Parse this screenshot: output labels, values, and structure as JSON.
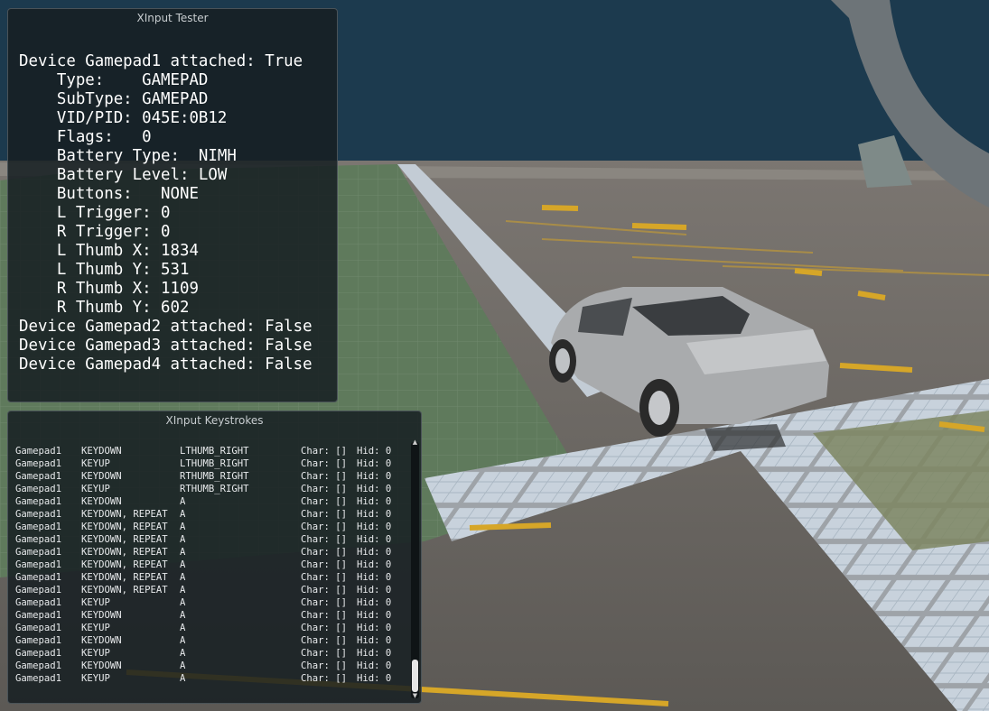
{
  "tester": {
    "title": "XInput Tester",
    "lines": [
      "Device Gamepad1 attached: True",
      "    Type:    GAMEPAD",
      "    SubType: GAMEPAD",
      "    VID/PID: 045E:0B12",
      "    Flags:   0",
      "    Battery Type:  NIMH",
      "    Battery Level: LOW",
      "    Buttons:   NONE",
      "    L Trigger: 0",
      "    R Trigger: 0",
      "    L Thumb X: 1834",
      "    L Thumb Y: 531",
      "    R Thumb X: 1109",
      "    R Thumb Y: 602",
      "Device Gamepad2 attached: False",
      "Device Gamepad3 attached: False",
      "Device Gamepad4 attached: False"
    ]
  },
  "keystrokes": {
    "title": "XInput Keystrokes",
    "rows": [
      {
        "device": "Gamepad1",
        "event": "KEYDOWN",
        "button": "LTHUMB_RIGHT",
        "char": "Char: []",
        "hid": "Hid: 0"
      },
      {
        "device": "Gamepad1",
        "event": "KEYUP",
        "button": "LTHUMB_RIGHT",
        "char": "Char: []",
        "hid": "Hid: 0"
      },
      {
        "device": "Gamepad1",
        "event": "KEYDOWN",
        "button": "RTHUMB_RIGHT",
        "char": "Char: []",
        "hid": "Hid: 0"
      },
      {
        "device": "Gamepad1",
        "event": "KEYUP",
        "button": "RTHUMB_RIGHT",
        "char": "Char: []",
        "hid": "Hid: 0"
      },
      {
        "device": "Gamepad1",
        "event": "KEYDOWN",
        "button": "A",
        "char": "Char: []",
        "hid": "Hid: 0"
      },
      {
        "device": "Gamepad1",
        "event": "KEYDOWN, REPEAT",
        "button": "A",
        "char": "Char: []",
        "hid": "Hid: 0"
      },
      {
        "device": "Gamepad1",
        "event": "KEYDOWN, REPEAT",
        "button": "A",
        "char": "Char: []",
        "hid": "Hid: 0"
      },
      {
        "device": "Gamepad1",
        "event": "KEYDOWN, REPEAT",
        "button": "A",
        "char": "Char: []",
        "hid": "Hid: 0"
      },
      {
        "device": "Gamepad1",
        "event": "KEYDOWN, REPEAT",
        "button": "A",
        "char": "Char: []",
        "hid": "Hid: 0"
      },
      {
        "device": "Gamepad1",
        "event": "KEYDOWN, REPEAT",
        "button": "A",
        "char": "Char: []",
        "hid": "Hid: 0"
      },
      {
        "device": "Gamepad1",
        "event": "KEYDOWN, REPEAT",
        "button": "A",
        "char": "Char: []",
        "hid": "Hid: 0"
      },
      {
        "device": "Gamepad1",
        "event": "KEYDOWN, REPEAT",
        "button": "A",
        "char": "Char: []",
        "hid": "Hid: 0"
      },
      {
        "device": "Gamepad1",
        "event": "KEYUP",
        "button": "A",
        "char": "Char: []",
        "hid": "Hid: 0"
      },
      {
        "device": "Gamepad1",
        "event": "KEYDOWN",
        "button": "A",
        "char": "Char: []",
        "hid": "Hid: 0"
      },
      {
        "device": "Gamepad1",
        "event": "KEYUP",
        "button": "A",
        "char": "Char: []",
        "hid": "Hid: 0"
      },
      {
        "device": "Gamepad1",
        "event": "KEYDOWN",
        "button": "A",
        "char": "Char: []",
        "hid": "Hid: 0"
      },
      {
        "device": "Gamepad1",
        "event": "KEYUP",
        "button": "A",
        "char": "Char: []",
        "hid": "Hid: 0"
      },
      {
        "device": "Gamepad1",
        "event": "KEYDOWN",
        "button": "A",
        "char": "Char: []",
        "hid": "Hid: 0"
      },
      {
        "device": "Gamepad1",
        "event": "KEYUP",
        "button": "A",
        "char": "Char: []",
        "hid": "Hid: 0"
      }
    ],
    "scroll_position": 1.0
  },
  "colors": {
    "sky": "#1c3a4e",
    "asphalt": "#6f6b66",
    "green_tiles": "#5f7a5c",
    "lane_stripe": "#d6a628",
    "panel_bg": "#161e22"
  }
}
